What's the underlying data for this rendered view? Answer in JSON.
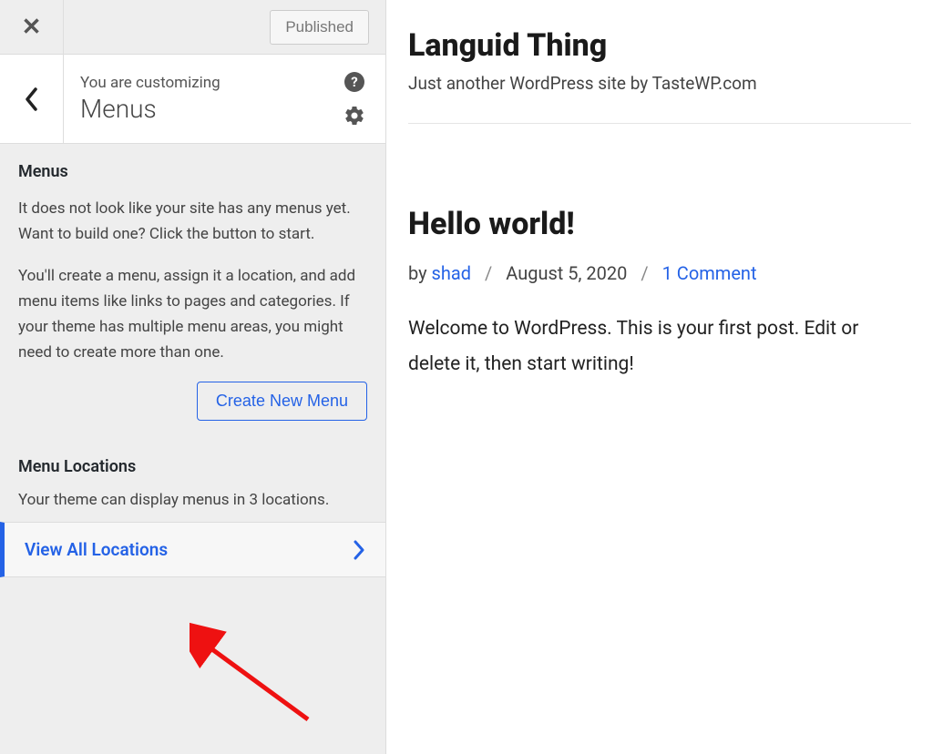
{
  "topbar": {
    "published_label": "Published"
  },
  "header": {
    "you_are": "You are customizing",
    "title": "Menus"
  },
  "menus_section": {
    "title": "Menus",
    "para1": "It does not look like your site has any menus yet. Want to build one? Click the button to start.",
    "para2": "You'll create a menu, assign it a location, and add menu items like links to pages and categories. If your theme has multiple menu areas, you might need to create more than one.",
    "create_btn": "Create New Menu"
  },
  "locations_section": {
    "title": "Menu Locations",
    "desc": "Your theme can display menus in 3 locations.",
    "view_all": "View All Locations"
  },
  "preview": {
    "site_title": "Languid Thing",
    "tagline": "Just another WordPress site by TasteWP.com",
    "post_title": "Hello world!",
    "by_label": "by ",
    "author": "shad",
    "date": "August 5, 2020",
    "comments": "1 Comment",
    "body": "Welcome to WordPress. This is your first post. Edit or delete it, then start writing!"
  }
}
